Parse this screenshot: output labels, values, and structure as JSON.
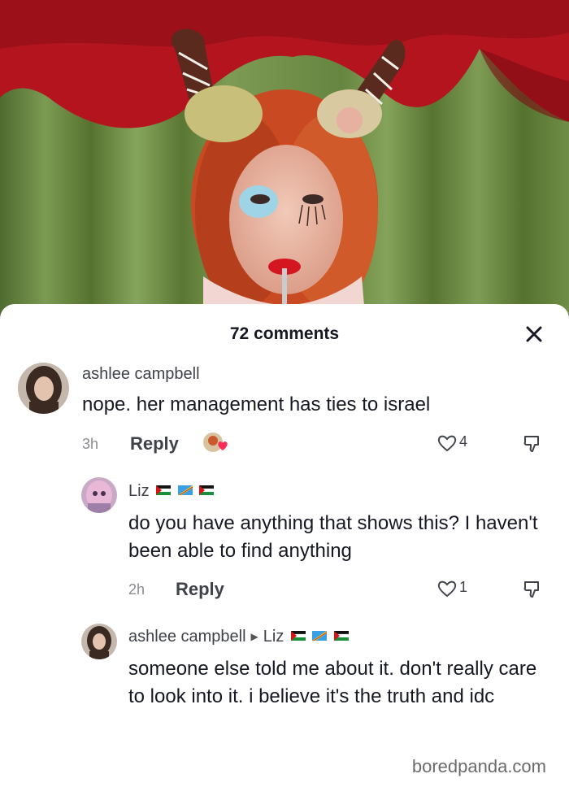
{
  "header": {
    "comment_count": "72 comments"
  },
  "comments": [
    {
      "author": "ashlee campbell",
      "text": "nope. her management has ties to israel",
      "time": "3h",
      "reply_label": "Reply",
      "likes": "4",
      "creator_liked": true
    },
    {
      "author": "Liz",
      "text": "do you have anything that shows this? I haven't been able to find anything",
      "time": "2h",
      "reply_label": "Reply",
      "likes": "1"
    },
    {
      "author": "ashlee campbell",
      "reply_to": "Liz",
      "text": "someone else told me about it. don't really care to look into it. i believe it's the truth and idc"
    }
  ],
  "watermark": "boredpanda.com",
  "colors": {
    "curtain_red": "#b3141e",
    "curtain_green": "#6a8a45",
    "hair": "#c94a22",
    "like_heart": "#fe2c55"
  }
}
